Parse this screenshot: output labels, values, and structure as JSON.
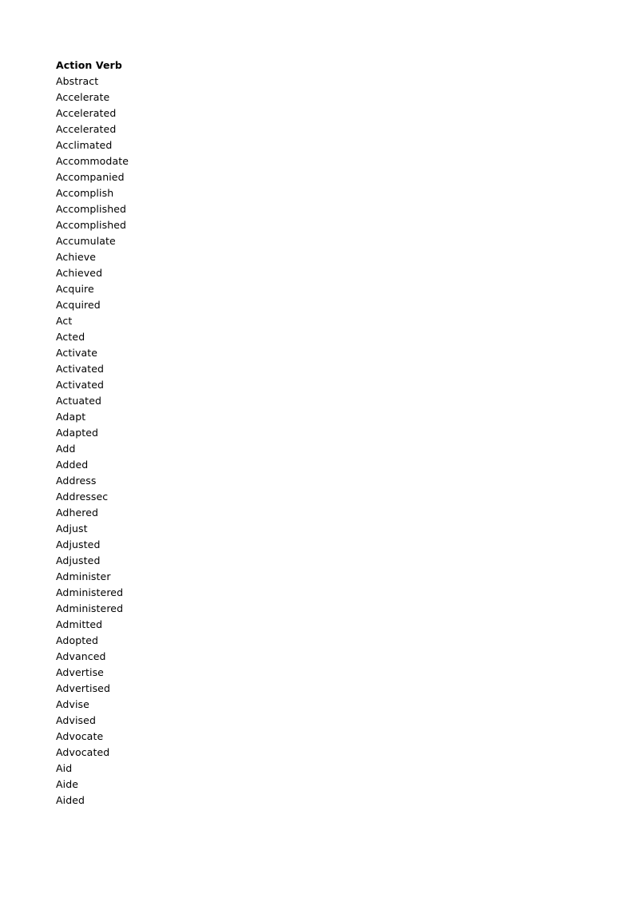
{
  "sheet": {
    "header": "Action Verb",
    "rows": [
      "Abstract",
      "Accelerate",
      "Accelerated",
      "Accelerated",
      "Acclimated",
      "Accommodate",
      "Accompanied",
      "Accomplish",
      "Accomplished",
      "Accomplished",
      "Accumulate",
      "Achieve",
      "Achieved",
      "Acquire",
      "Acquired",
      "Act",
      "Acted",
      "Activate",
      "Activated",
      "Activated",
      "Actuated",
      "Adapt",
      "Adapted",
      "Add",
      "Added",
      "Address",
      "Addressec",
      "Adhered",
      "Adjust",
      "Adjusted",
      "Adjusted",
      "Administer",
      "Administered",
      "Administered",
      "Admitted",
      "Adopted",
      "Advanced",
      "Advertise",
      "Advertised",
      "Advise",
      "Advised",
      "Advocate",
      "Advocated",
      "Aid",
      "Aide",
      "Aided"
    ]
  }
}
